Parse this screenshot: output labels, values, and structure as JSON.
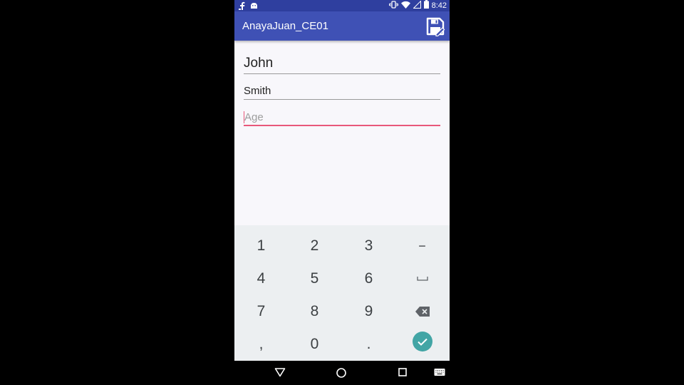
{
  "status_bar": {
    "time": "8:42",
    "left_icons": [
      "facebook-icon",
      "android-icon"
    ],
    "right_icons": [
      "vibrate-icon",
      "wifi-icon",
      "signal-icon",
      "battery-icon"
    ]
  },
  "app_bar": {
    "title": "AnayaJuan_CE01",
    "action_icon": "save-icon"
  },
  "form": {
    "first_name_value": "John",
    "last_name_value": "Smith",
    "age_placeholder": "Age"
  },
  "keyboard": {
    "row1": [
      "1",
      "2",
      "3",
      "−"
    ],
    "row2": [
      "4",
      "5",
      "6"
    ],
    "row3": [
      "7",
      "8",
      "9"
    ],
    "row4": [
      ",",
      "0",
      "."
    ],
    "special_icons": [
      "space-icon",
      "backspace-icon",
      "done-check-icon"
    ],
    "accent_color": "#42a5a5"
  },
  "nav_bar": {
    "icons": [
      "back-icon",
      "home-icon",
      "recents-icon",
      "keyboard-switch-icon"
    ]
  },
  "colors": {
    "app_bar": "#3f51b5",
    "status_bar": "#2f3f9f",
    "focus_underline": "#e8587a"
  }
}
